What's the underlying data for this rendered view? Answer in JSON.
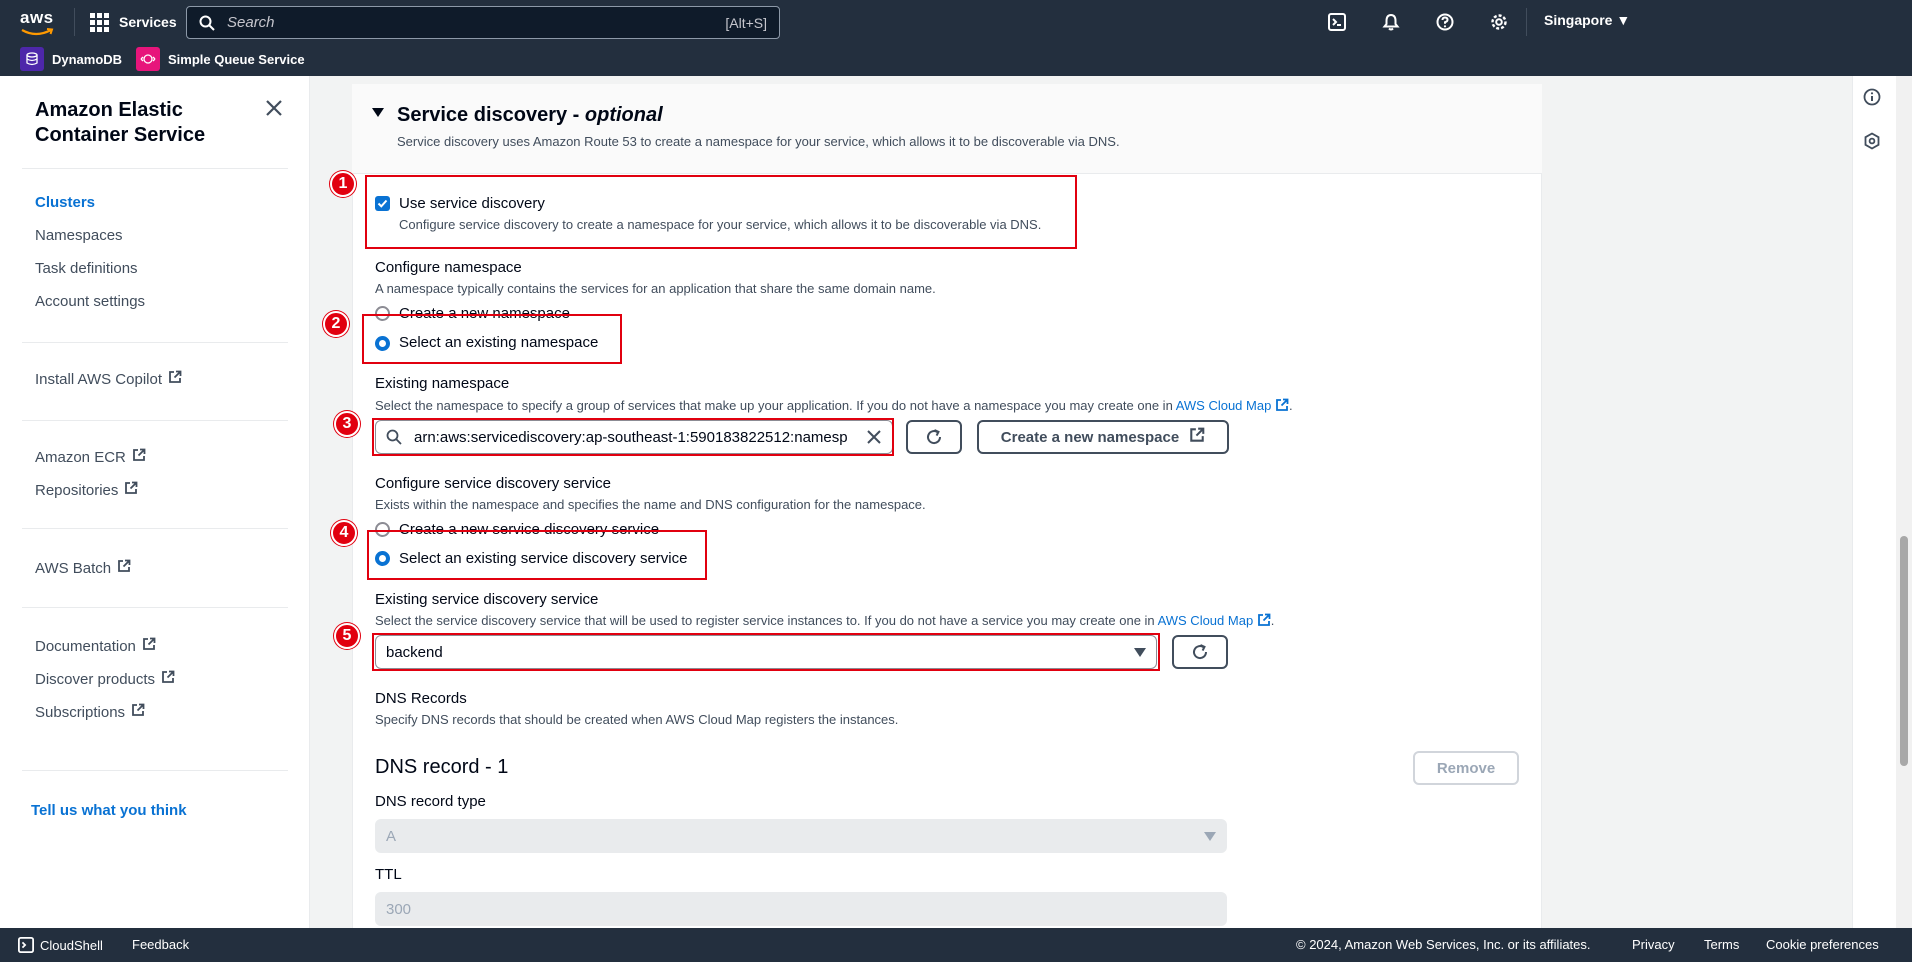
{
  "topnav": {
    "logo": "aws",
    "services_label": "Services",
    "search_placeholder": "Search",
    "search_shortcut": "[Alt+S]",
    "region": "Singapore ▼",
    "favorites": [
      {
        "label": "DynamoDB",
        "color": "#4d27aa"
      },
      {
        "label": "Simple Queue Service",
        "color": "#e7157b"
      }
    ]
  },
  "sidebar": {
    "title": "Amazon Elastic Container Service",
    "items": [
      {
        "label": "Clusters",
        "active": true
      },
      {
        "label": "Namespaces"
      },
      {
        "label": "Task definitions"
      },
      {
        "label": "Account settings"
      },
      {
        "label": "Install AWS Copilot",
        "external": true
      },
      {
        "label": "Amazon ECR",
        "external": true
      },
      {
        "label": "Repositories",
        "external": true
      },
      {
        "label": "AWS Batch",
        "external": true
      },
      {
        "label": "Documentation",
        "external": true
      },
      {
        "label": "Discover products",
        "external": true
      },
      {
        "label": "Subscriptions",
        "external": true
      }
    ],
    "feedback": "Tell us what you think"
  },
  "main": {
    "section_title": "Service discovery - ",
    "section_title_optional": "optional",
    "section_desc": "Service discovery uses Amazon Route 53 to create a namespace for your service, which allows it to be discoverable via DNS.",
    "use_sd": {
      "label": "Use service discovery",
      "desc": "Configure service discovery to create a namespace for your service, which allows it to be discoverable via DNS.",
      "checked": true
    },
    "configure_namespace": {
      "label": "Configure namespace",
      "desc": "A namespace typically contains the services for an application that share the same domain name.",
      "option_new": "Create a new namespace",
      "option_existing": "Select an existing namespace",
      "selected": "existing"
    },
    "existing_namespace": {
      "label": "Existing namespace",
      "desc": "Select the namespace to specify a group of services that make up your application. If you do not have a namespace you may create one in ",
      "link": "AWS Cloud Map",
      "desc_end": ".",
      "value": "arn:aws:servicediscovery:ap-southeast-1:590183822512:namesp",
      "create_button": "Create a new namespace"
    },
    "configure_sds": {
      "label": "Configure service discovery service",
      "desc": "Exists within the namespace and specifies the name and DNS configuration for the namespace.",
      "option_new": "Create a new service discovery service",
      "option_existing": "Select an existing service discovery service",
      "selected": "existing"
    },
    "existing_sds": {
      "label": "Existing service discovery service",
      "desc": "Select the service discovery service that will be used to register service instances to. If you do not have a service you may create one in ",
      "link": "AWS Cloud Map",
      "desc_end": ".",
      "value": "backend"
    },
    "dns_records": {
      "label": "DNS Records",
      "desc": "Specify DNS records that should be created when AWS Cloud Map registers the instances."
    },
    "dns_record_1": {
      "title": "DNS record - 1",
      "remove": "Remove",
      "type_label": "DNS record type",
      "type_value": "A",
      "ttl_label": "TTL",
      "ttl_value": "300"
    },
    "markers": [
      "1",
      "2",
      "3",
      "4",
      "5"
    ]
  },
  "footer": {
    "cloudshell": "CloudShell",
    "feedback": "Feedback",
    "copyright": "© 2024, Amazon Web Services, Inc. or its affiliates.",
    "privacy": "Privacy",
    "terms": "Terms",
    "cookies": "Cookie preferences"
  },
  "colors": {
    "nav_bg": "#232f3e",
    "accent": "#0972d3",
    "highlight": "#e1000f"
  }
}
